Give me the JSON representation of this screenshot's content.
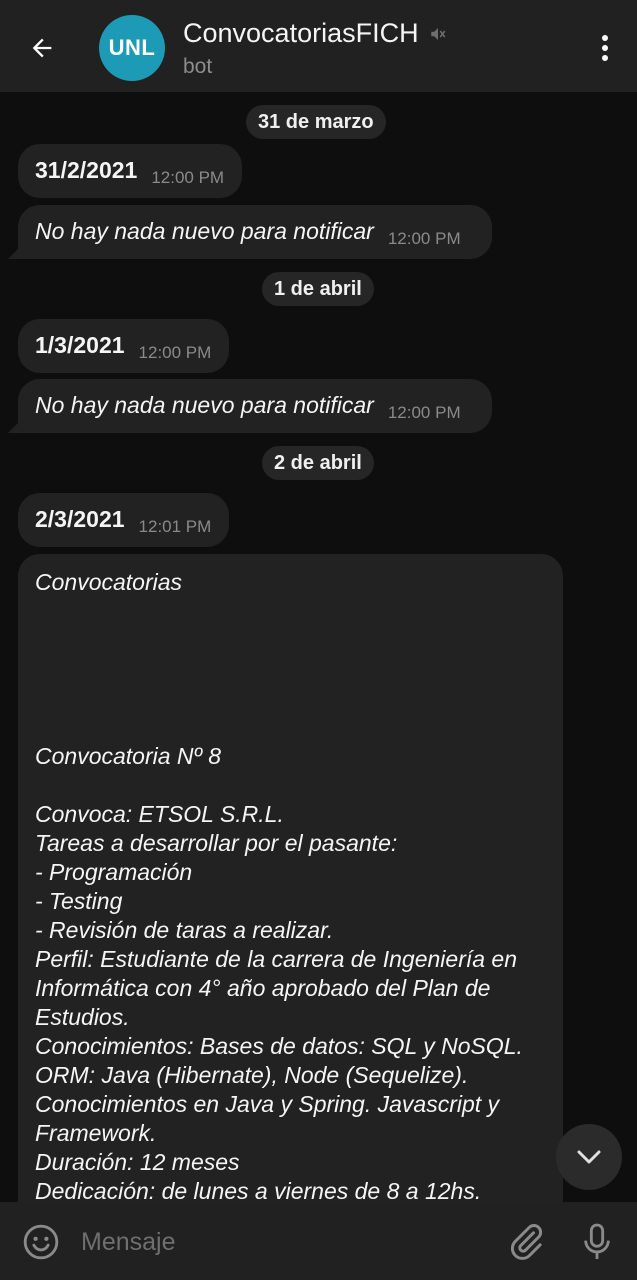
{
  "header": {
    "back_icon": "arrow-left-icon",
    "avatar_text": "UNL",
    "avatar_color": "#1d9bb6",
    "title": "ConvocatoriasFICH",
    "muted_icon": "muted-speaker-icon",
    "subtitle": "bot",
    "menu_icon": "more-vertical-icon"
  },
  "messages": {
    "date1": "31 de marzo",
    "m1_text": "31/2/2021",
    "m1_time": "12:00 PM",
    "m2_text": "No hay nada nuevo para notificar",
    "m2_time": "12:00 PM",
    "date2": "1 de abril",
    "m3_text": "1/3/2021",
    "m3_time": "12:00 PM",
    "m4_text": "No hay nada nuevo para notificar",
    "m4_time": "12:00 PM",
    "date3": "2 de abril",
    "m5_text": "2/3/2021",
    "m5_time": "12:01 PM",
    "long": {
      "l1": "Convocatorias",
      "l2": "Convocatoria Nº 8",
      "l3": "Convoca: ETSOL S.R.L.",
      "l4": "Tareas a desarrollar por el pasante:",
      "l5": "- Programación",
      "l6": "- Testing",
      "l7": "- Revisión de taras a realizar.",
      "l8": "Perfil: Estudiante de la carrera de Ingeniería en",
      "l9": "Informática con 4° año aprobado del Plan de",
      "l10": "Estudios.",
      "l11": "Conocimientos: Bases de datos: SQL y NoSQL.",
      "l12": "ORM: Java (Hibernate), Node (Sequelize).",
      "l13": "Conocimientos en Java y Spring. Javascript y",
      "l14": "Framework.",
      "l15": "Duración: 12 meses",
      "l16": "Dedicación: de lunes a viernes de 8 a 12hs."
    }
  },
  "composer": {
    "placeholder": "Mensaje",
    "emoji_icon": "emoji-icon",
    "attach_icon": "paperclip-icon",
    "mic_icon": "microphone-icon"
  },
  "scroll_down_icon": "chevron-down-icon"
}
